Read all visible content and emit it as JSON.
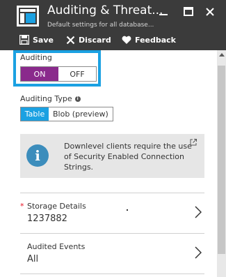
{
  "header": {
    "title": "Auditing & Threat...",
    "subtitle": "Default settings for all database..."
  },
  "toolbar": {
    "save_label": "Save",
    "discard_label": "Discard",
    "feedback_label": "Feedback"
  },
  "auditing": {
    "label": "Auditing",
    "on_label": "ON",
    "off_label": "OFF",
    "selected": "ON"
  },
  "auditing_type": {
    "label": "Auditing Type",
    "options": [
      "Table",
      "Blob (preview)"
    ],
    "selected": "Table"
  },
  "info_banner": {
    "text": "Downlevel clients require the use of Security Enabled Connection Strings."
  },
  "storage_details": {
    "required_marker": "*",
    "label": "Storage Details",
    "value": "1237882"
  },
  "audited_events": {
    "label": "Audited Events",
    "value": "All"
  },
  "colors": {
    "header_bg": "#3b3b3b",
    "toggle_on": "#8a2a8c",
    "accent_blue": "#1ba1e2",
    "info_icon": "#3c8dbc"
  },
  "icons": {
    "blade_icon": "blade-icon",
    "minimize": "minimize-icon",
    "maximize": "maximize-icon",
    "close": "close-icon",
    "save": "save-icon",
    "discard": "x-icon",
    "feedback": "heart-icon",
    "info": "info-icon",
    "external_link": "external-link-icon",
    "chevron": "chevron-right-icon"
  }
}
